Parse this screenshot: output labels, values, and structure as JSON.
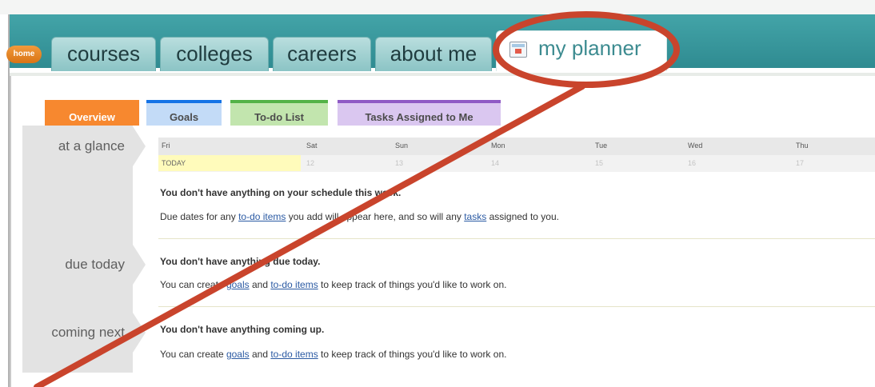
{
  "nav": {
    "home_label": "home",
    "tabs": [
      {
        "label": "courses"
      },
      {
        "label": "colleges"
      },
      {
        "label": "careers"
      },
      {
        "label": "about me"
      },
      {
        "label": "my planner"
      }
    ]
  },
  "subtabs": [
    {
      "label": "Overview",
      "color": "#f7882f"
    },
    {
      "label": "Goals",
      "color": "#1473e6"
    },
    {
      "label": "To-do List",
      "color": "#53b247"
    },
    {
      "label": "Tasks Assigned to Me",
      "color": "#8f5ac5"
    }
  ],
  "sections": {
    "at_a_glance": "at a glance",
    "due_today": "due today",
    "coming_next": "coming next"
  },
  "calendar": {
    "days": [
      "Fri",
      "Sat",
      "Sun",
      "Mon",
      "Tue",
      "Wed",
      "Thu"
    ],
    "dates": [
      "TODAY",
      "12",
      "13",
      "14",
      "15",
      "16",
      "17"
    ]
  },
  "glance": {
    "heading": "You don't have anything on your schedule this week.",
    "text_before": "Due dates for any ",
    "link1": "to-do items",
    "text_middle": " you add will appear here, and so will any ",
    "link2": "tasks",
    "text_after": " assigned to you."
  },
  "due": {
    "heading": "You don't have anything due today.",
    "text_before": "You can create ",
    "link1": "goals",
    "text_middle": " and ",
    "link2": "to-do items",
    "text_after": " to keep track of things you'd like to work on."
  },
  "coming": {
    "heading": "You don't have anything coming up.",
    "text_before": "You can create ",
    "link1": "goals",
    "text_middle": " and ",
    "link2": "to-do items",
    "text_after": " to keep track of things you'd like to work on."
  },
  "colors": {
    "nav_teal": "#3c9ea3",
    "annotation_red": "#c9442c",
    "today_highlight": "#fffbbb"
  }
}
